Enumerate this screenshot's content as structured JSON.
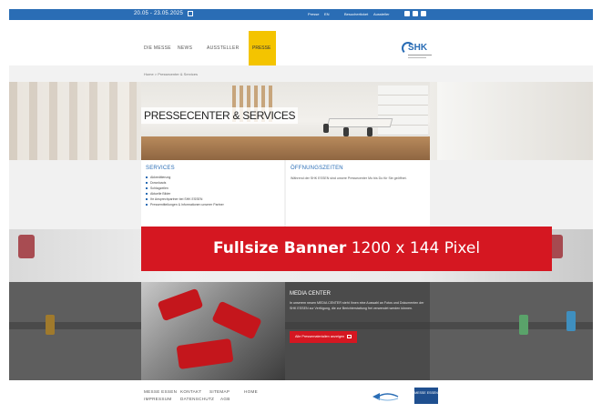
{
  "topbar": {
    "date": "20.05 - 23.05.2025",
    "links": [
      "Presse",
      "EN",
      "Besucherticket",
      "Aussteller"
    ],
    "social_icons": [
      "facebook-icon",
      "instagram-icon",
      "linkedin-icon"
    ]
  },
  "nav": {
    "items": [
      "DIE MESSE",
      "NEWS",
      "AUSSTELLER",
      "PRESSE"
    ],
    "active": "PRESSE"
  },
  "logo": {
    "text": "SHK"
  },
  "breadcrumb": "Home  >  Pressecenter & Services",
  "hero": {
    "title": "PRESSECENTER & SERVICES"
  },
  "services": {
    "title": "SERVICES",
    "items": [
      "Akkreditierung",
      "Downloads",
      "Schlagzeilen",
      "Aktuelle Bilder",
      "Ihr Ansprechpartner bei SHK ESSEN",
      "Pressemitteilungen & Informationen unserer Partner"
    ]
  },
  "hours": {
    "title": "ÖFFNUNGSZEITEN",
    "text": "Während der SHK ESSEN sind unsere Pressecenter Mo bis Do für Sie geöffnet."
  },
  "banner": {
    "bold": "Fullsize Banner",
    "size": "1200 x 144",
    "unit": "Pixel"
  },
  "media": {
    "title": "MEDIA CENTER",
    "text": "In unserem neuen MEDIA CENTER steht Ihnen eine Auswahl an Fotos und Dokumenten der SHK ESSEN zur Verfügung, die zur Berichterstattung frei verwendet werden können.",
    "button": "Alle Pressematerialien anzeigen"
  },
  "footer": {
    "row1": [
      "MESSE ESSEN",
      "KONTAKT",
      "SITEMAP",
      "HOME"
    ],
    "row2": [
      "IMPRESSUM",
      "DATENSCHUTZ",
      "AGB"
    ],
    "logo2_text": "MESSE ESSEN"
  },
  "colors": {
    "accent_blue": "#2a6db5",
    "active_nav": "#f4c400",
    "banner_red": "#d51721"
  }
}
